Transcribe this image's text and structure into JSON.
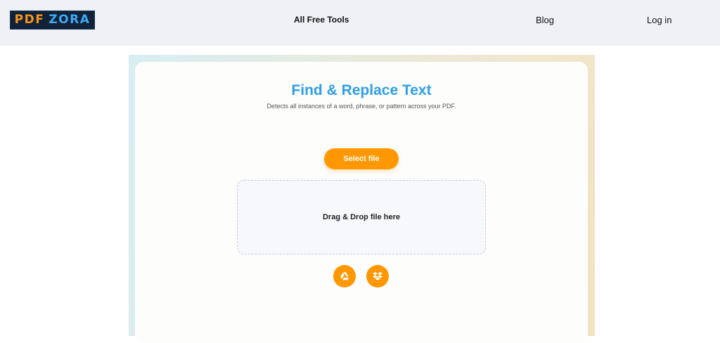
{
  "header": {
    "logo": {
      "part1": "PDF",
      "part2": "ZORA"
    },
    "nav": {
      "all_free_tools": "All Free Tools",
      "blog": "Blog",
      "login": "Log in"
    }
  },
  "tool": {
    "title": "Find & Replace Text",
    "subtitle": "Detects all instances of a word, phrase, or pattern across your PDF.",
    "select_file_label": "Select file",
    "dropzone_label": "Drag & Drop file here",
    "cloud_sources": [
      {
        "icon": "google-drive-icon"
      },
      {
        "icon": "dropbox-icon"
      }
    ]
  },
  "colors": {
    "accent_orange": "#ff9800",
    "title_blue": "#2f9fe8",
    "navbar_bg": "#f0f1f5"
  }
}
